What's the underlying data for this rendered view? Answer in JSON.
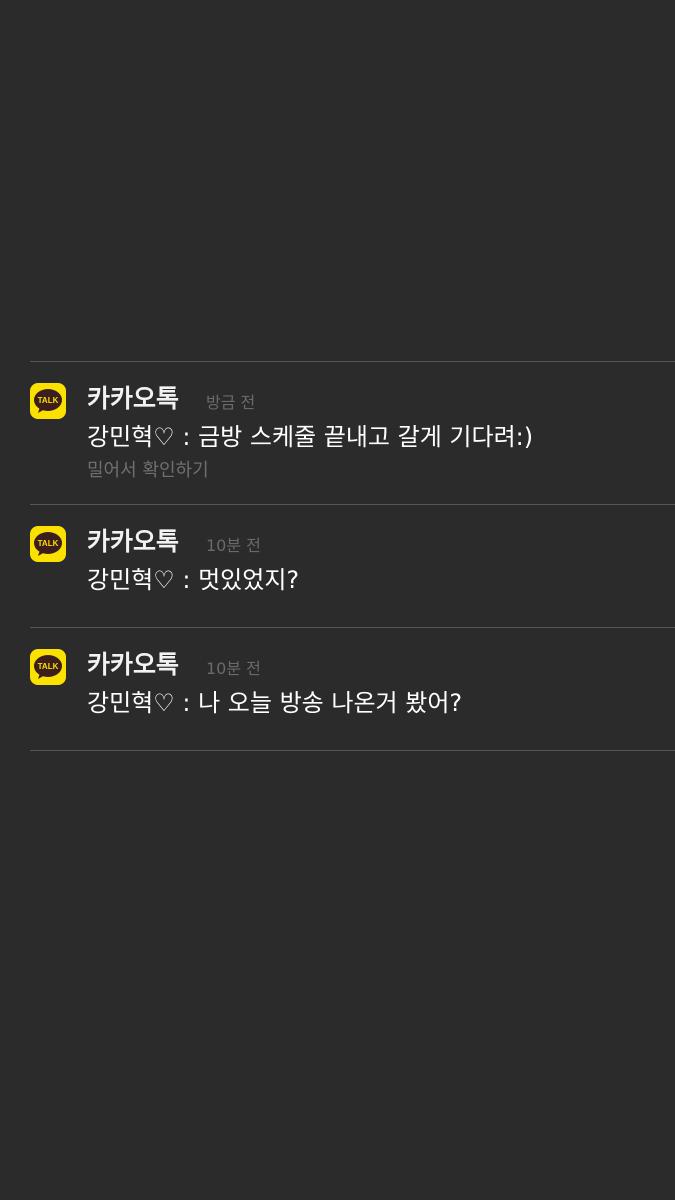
{
  "notifications": [
    {
      "app_name": "카카오톡",
      "time": "방금 전",
      "message": "강민혁♡ : 금방 스케줄 끝내고 갈게 기다려:)",
      "hint": "밀어서 확인하기"
    },
    {
      "app_name": "카카오톡",
      "time": "10분 전",
      "message": "강민혁♡ : 멋있었지?"
    },
    {
      "app_name": "카카오톡",
      "time": "10분 전",
      "message": "강민혁♡ : 나 오늘 방송 나온거 봤어?"
    }
  ],
  "icon": {
    "name": "kakaotalk-icon",
    "label": "TALK",
    "background": "#fae100",
    "bubble": "#3c1e1e"
  }
}
